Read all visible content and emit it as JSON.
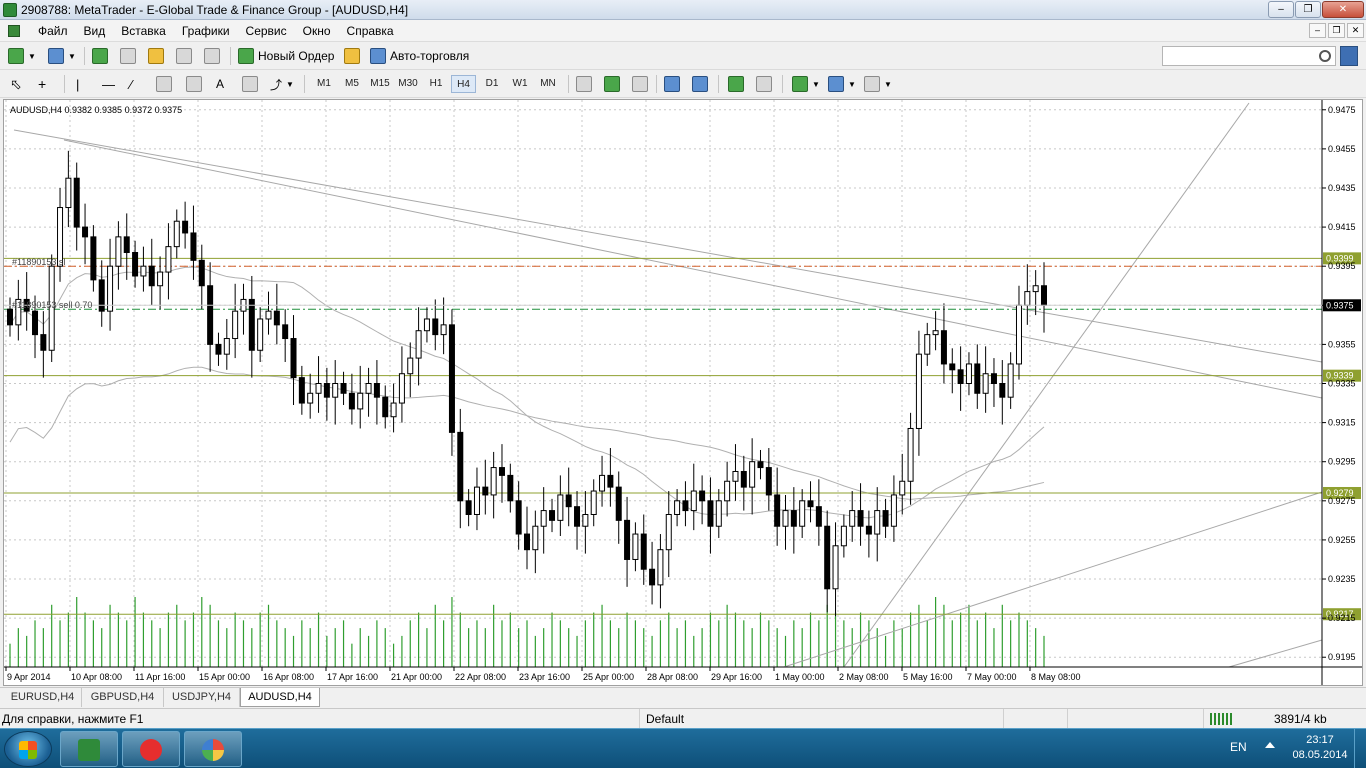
{
  "window": {
    "title": "2908788: MetaTrader - E-Global Trade & Finance Group - [AUDUSD,H4]"
  },
  "menu": [
    "Файл",
    "Вид",
    "Вставка",
    "Графики",
    "Сервис",
    "Окно",
    "Справка"
  ],
  "toolbar": {
    "new_order_label": "Новый Ордер",
    "autotrading_label": "Авто-торговля",
    "timeframes": [
      "M1",
      "M5",
      "M15",
      "M30",
      "H1",
      "H4",
      "D1",
      "W1",
      "MN"
    ],
    "active_timeframe": "H4",
    "search": {
      "value": "",
      "placeholder": ""
    }
  },
  "chart": {
    "symbol_info": "AUDUSD,H4  0.9382 0.9385 0.9372 0.9375",
    "order_labels": [
      "#11890153 sl",
      "#11890153 sell 0.70"
    ],
    "price_ticks": [
      "0.9475",
      "0.9455",
      "0.9435",
      "0.9415",
      "0.9395",
      "0.9375",
      "0.9355",
      "0.9335",
      "0.9315",
      "0.9295",
      "0.9275",
      "0.9255",
      "0.9235",
      "0.9215",
      "0.9195"
    ],
    "time_ticks": [
      "9 Apr 2014",
      "10 Apr 08:00",
      "11 Apr 16:00",
      "15 Apr 00:00",
      "16 Apr 08:00",
      "17 Apr 16:00",
      "21 Apr 00:00",
      "22 Apr 08:00",
      "23 Apr 16:00",
      "25 Apr 00:00",
      "28 Apr 08:00",
      "29 Apr 16:00",
      "1 May 00:00",
      "2 May 08:00",
      "5 May 16:00",
      "7 May 00:00",
      "8 May 08:00"
    ],
    "current_price": "0.9375",
    "level_labels": [
      "0.9399",
      "0.9339",
      "0.9279",
      "0.9217"
    ],
    "colors": {
      "bull_candle": "#ffffff",
      "bear_candle": "#000000",
      "level_line": "#8fa030",
      "sl_line": "#d4602a",
      "entry_line": "#1f8f3a",
      "volume": "#2f9e2f",
      "price_tag_bg": "#000000",
      "level_tag_bg": "#8fa030"
    }
  },
  "chart_data": {
    "type": "candlestick",
    "symbol": "AUDUSD",
    "timeframe": "H4",
    "ohlc_last": {
      "open": 0.9382,
      "high": 0.9385,
      "low": 0.9372,
      "close": 0.9375
    },
    "y_range": [
      0.919,
      0.948
    ],
    "horizontal_levels": [
      {
        "price": 0.9399,
        "label": "0.9399"
      },
      {
        "price": 0.9339,
        "label": "0.9339"
      },
      {
        "price": 0.9279,
        "label": "0.9279"
      },
      {
        "price": 0.9217,
        "label": "0.9217"
      }
    ],
    "orders": [
      {
        "label": "#11890153 sl",
        "price": 0.9395
      },
      {
        "label": "#11890153 sell 0.70",
        "price": 0.9373
      }
    ],
    "closes": [
      0.9365,
      0.9378,
      0.9372,
      0.936,
      0.9352,
      0.9395,
      0.9425,
      0.944,
      0.9415,
      0.941,
      0.9388,
      0.9372,
      0.9395,
      0.941,
      0.9402,
      0.939,
      0.9395,
      0.9385,
      0.9392,
      0.9405,
      0.9418,
      0.9412,
      0.9398,
      0.9385,
      0.9355,
      0.935,
      0.9358,
      0.9372,
      0.9378,
      0.9352,
      0.9368,
      0.9372,
      0.9365,
      0.9358,
      0.9338,
      0.9325,
      0.933,
      0.9335,
      0.9328,
      0.9335,
      0.933,
      0.9322,
      0.933,
      0.9335,
      0.9328,
      0.9318,
      0.9325,
      0.934,
      0.9348,
      0.9362,
      0.9368,
      0.936,
      0.9365,
      0.931,
      0.9275,
      0.9268,
      0.9282,
      0.9278,
      0.9292,
      0.9288,
      0.9275,
      0.9258,
      0.925,
      0.9262,
      0.927,
      0.9265,
      0.9278,
      0.9272,
      0.9262,
      0.9268,
      0.928,
      0.9288,
      0.9282,
      0.9265,
      0.9245,
      0.9258,
      0.924,
      0.9232,
      0.925,
      0.9268,
      0.9275,
      0.927,
      0.928,
      0.9275,
      0.9262,
      0.9275,
      0.9285,
      0.929,
      0.9282,
      0.9295,
      0.9292,
      0.9278,
      0.9262,
      0.927,
      0.9262,
      0.9275,
      0.9272,
      0.9262,
      0.923,
      0.9252,
      0.9262,
      0.927,
      0.9262,
      0.9258,
      0.927,
      0.9262,
      0.9278,
      0.9285,
      0.9312,
      0.935,
      0.936,
      0.9362,
      0.9345,
      0.9342,
      0.9335,
      0.9345,
      0.933,
      0.934,
      0.9335,
      0.9328,
      0.9345,
      0.9375,
      0.9382,
      0.9385,
      0.9375
    ],
    "volumes": [
      3,
      5,
      4,
      6,
      5,
      8,
      6,
      7,
      9,
      7,
      6,
      5,
      8,
      7,
      6,
      9,
      7,
      6,
      5,
      7,
      8,
      6,
      7,
      9,
      8,
      6,
      5,
      7,
      6,
      5,
      7,
      8,
      6,
      5,
      4,
      6,
      5,
      7,
      4,
      5,
      6,
      3,
      5,
      4,
      6,
      5,
      3,
      4,
      6,
      7,
      5,
      8,
      6,
      9,
      7,
      5,
      6,
      5,
      8,
      6,
      7,
      5,
      6,
      4,
      5,
      7,
      6,
      5,
      4,
      6,
      7,
      8,
      6,
      5,
      7,
      6,
      5,
      4,
      6,
      7,
      5,
      6,
      4,
      5,
      7,
      6,
      8,
      7,
      6,
      5,
      7,
      6,
      5,
      4,
      6,
      5,
      7,
      6,
      8,
      7,
      6,
      5,
      7,
      6,
      5,
      4,
      6,
      5,
      7,
      8,
      6,
      9,
      8,
      6,
      7,
      8,
      6,
      7,
      5,
      8,
      6,
      7,
      6,
      5,
      4
    ]
  },
  "tabs": [
    "EURUSD,H4",
    "GBPUSD,H4",
    "USDJPY,H4",
    "AUDUSD,H4"
  ],
  "active_tab": "AUDUSD,H4",
  "status": {
    "help": "Для справки, нажмите F1",
    "profile": "Default",
    "traffic": "3891/4 kb"
  },
  "taskbar": {
    "lang": "EN",
    "time": "23:17",
    "date": "08.05.2014"
  }
}
